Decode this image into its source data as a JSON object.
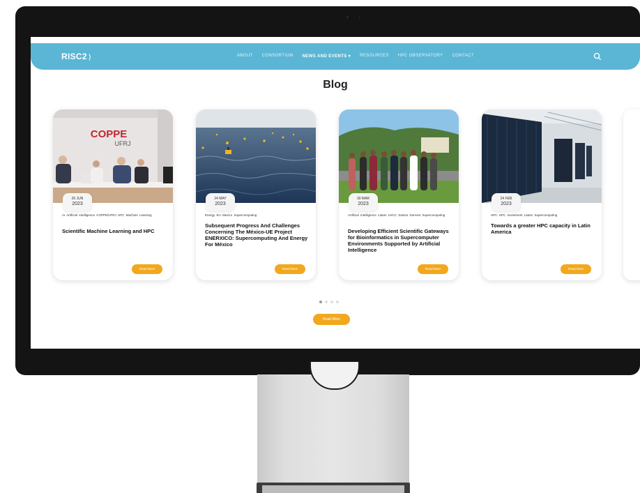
{
  "navbar": {
    "logo_text": "RISC2",
    "items": [
      "ABOUT",
      "CONSORTIUM",
      "NEWS AND EVENTS ▾",
      "RESOURCES",
      "HPC OBSERVATORY",
      "CONTACT"
    ],
    "active_index": 2,
    "search_icon": "search-icon",
    "color": "#5bb5d5"
  },
  "page": {
    "title": "Blog"
  },
  "cards": [
    {
      "day": "26 JUN",
      "year": "2023",
      "tags": "AI   Artificial Intelligence   COPPE/UFRJ   HPC   Machine Learning",
      "title": "Scientific Machine Learning and HPC",
      "read_more": "Read More",
      "image": {
        "logo_line1": "COPPE",
        "logo_line2": "UFRJ"
      }
    },
    {
      "day": "24 MAY",
      "year": "2023",
      "tags": "Energy   EU   Mexico   Supercomputing",
      "title": "Subsequent Progress And Challenges Concerning The México-UE Project ENERXICO: Supercomputing And Energy For México",
      "read_more": "Read More"
    },
    {
      "day": "30 MAR",
      "year": "2023",
      "tags": "Artificial Intelligence   Latam   LNCC   Santos Dumont Supercomputing",
      "title": "Developing Efficient Scientific Gateways for Bioinformatics in Supercomputer Environments Supported by Artificial Intelligence",
      "read_more": "Read More"
    },
    {
      "day": "24 FEB",
      "year": "2023",
      "tags": "HPC   HPC Investment   Latam   Supercomputing",
      "title": "Towards a greater HPC capacity in Latin America",
      "read_more": "Read More"
    }
  ],
  "carousel": {
    "dot_count": 4,
    "active": 0
  },
  "main_button": "Read More",
  "accent_color": "#f2a81d"
}
